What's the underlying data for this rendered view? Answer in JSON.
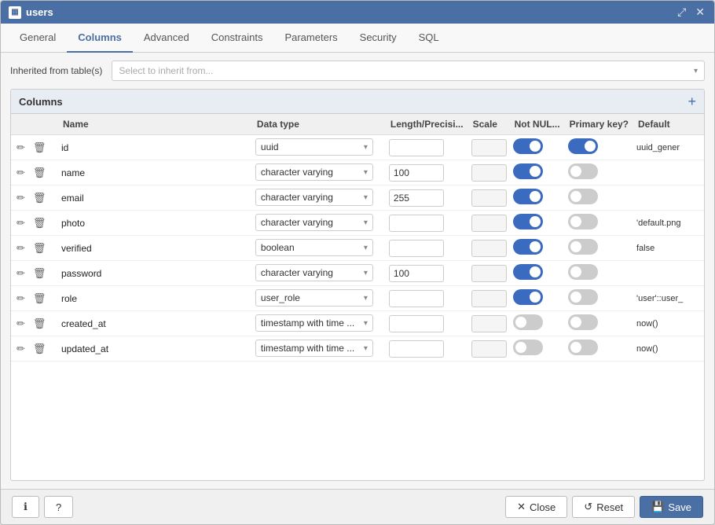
{
  "dialog": {
    "title": "users",
    "icon": "table-icon"
  },
  "tabs": [
    {
      "id": "general",
      "label": "General",
      "active": false
    },
    {
      "id": "columns",
      "label": "Columns",
      "active": true
    },
    {
      "id": "advanced",
      "label": "Advanced",
      "active": false
    },
    {
      "id": "constraints",
      "label": "Constraints",
      "active": false
    },
    {
      "id": "parameters",
      "label": "Parameters",
      "active": false
    },
    {
      "id": "security",
      "label": "Security",
      "active": false
    },
    {
      "id": "sql",
      "label": "SQL",
      "active": false
    }
  ],
  "inherit": {
    "label": "Inherited from table(s)",
    "placeholder": "Select to inherit from..."
  },
  "columns_section": {
    "title": "Columns",
    "add_label": "+"
  },
  "table_headers": {
    "col1": "",
    "name": "Name",
    "data_type": "Data type",
    "length": "Length/Precisi...",
    "scale": "Scale",
    "not_null": "Not NUL...",
    "primary_key": "Primary key?",
    "default": "Default"
  },
  "rows": [
    {
      "name": "id",
      "data_type": "uuid",
      "length": "",
      "scale": "",
      "not_null": true,
      "primary_key": true,
      "default": "uuid_gener"
    },
    {
      "name": "name",
      "data_type": "character varying",
      "length": "100",
      "scale": "",
      "not_null": true,
      "primary_key": false,
      "default": ""
    },
    {
      "name": "email",
      "data_type": "character varying",
      "length": "255",
      "scale": "",
      "not_null": true,
      "primary_key": false,
      "default": ""
    },
    {
      "name": "photo",
      "data_type": "character varying",
      "length": "",
      "scale": "",
      "not_null": true,
      "primary_key": false,
      "default": "'default.png"
    },
    {
      "name": "verified",
      "data_type": "boolean",
      "length": "",
      "scale": "",
      "not_null": true,
      "primary_key": false,
      "default": "false"
    },
    {
      "name": "password",
      "data_type": "character varying",
      "length": "100",
      "scale": "",
      "not_null": true,
      "primary_key": false,
      "default": ""
    },
    {
      "name": "role",
      "data_type": "user_role",
      "length": "",
      "scale": "",
      "not_null": true,
      "primary_key": false,
      "default": "'user'::user_"
    },
    {
      "name": "created_at",
      "data_type": "timestamp with time ...",
      "length": "",
      "scale": "",
      "not_null": false,
      "primary_key": false,
      "default": "now()"
    },
    {
      "name": "updated_at",
      "data_type": "timestamp with time ...",
      "length": "",
      "scale": "",
      "not_null": false,
      "primary_key": false,
      "default": "now()"
    }
  ],
  "footer": {
    "info_icon": "info-icon",
    "help_icon": "help-icon",
    "close_label": "Close",
    "reset_label": "Reset",
    "save_label": "Save"
  }
}
